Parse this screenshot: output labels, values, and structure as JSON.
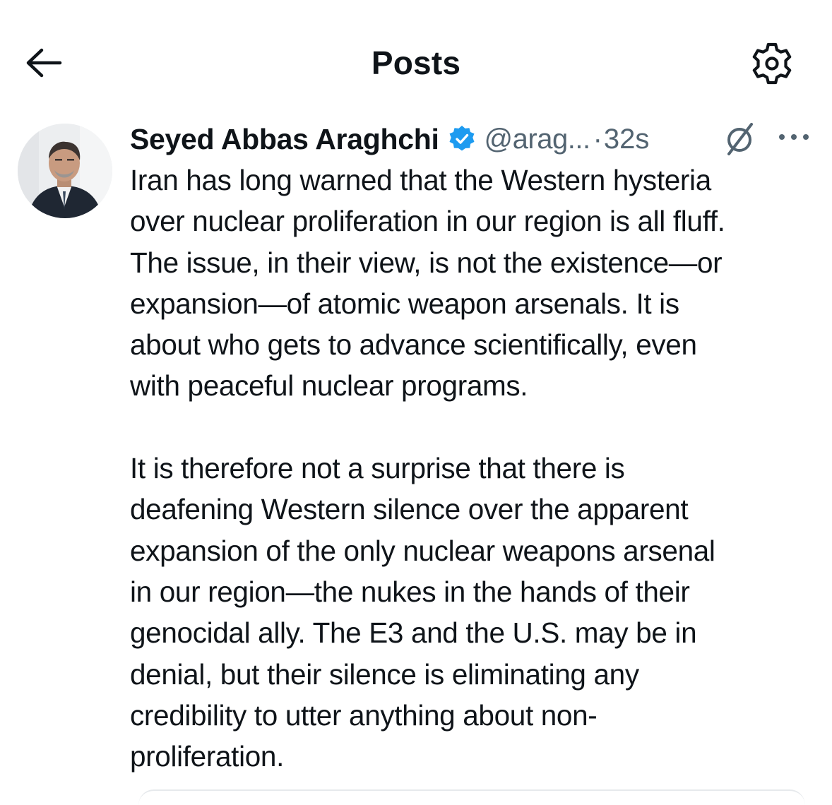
{
  "header": {
    "title": "Posts",
    "back_icon": "arrow-left-icon",
    "settings_icon": "gear-icon"
  },
  "post": {
    "author": {
      "name": "Seyed Abbas Araghchi",
      "handle": "@arag...",
      "verified": true,
      "verified_color": "#1d9bf0",
      "avatar_icon": "avatar-photo"
    },
    "separator": "·",
    "time": "32s",
    "grok_icon": "grok-icon",
    "more_icon": "more-horizontal-icon",
    "text": "Iran has long warned that the Western hysteria\nover nuclear proliferation in our region is all fluff.\nThe issue, in their view, is not the existence—or\nexpansion—of atomic weapon arsenals. It is\nabout who gets to advance scientifically, even\nwith peaceful nuclear programs.\n\nIt is therefore not a surprise that there is\ndeafening Western silence over the apparent\nexpansion of the only nuclear weapons arsenal\nin our region—the nukes in the hands of their\ngenocidal ally. The E3 and the U.S. may be in\ndenial, but their silence is eliminating any\ncredibility to utter anything about non-\nproliferation."
  },
  "colors": {
    "text_primary": "#0f1419",
    "text_secondary": "#536471",
    "background": "#ffffff"
  }
}
